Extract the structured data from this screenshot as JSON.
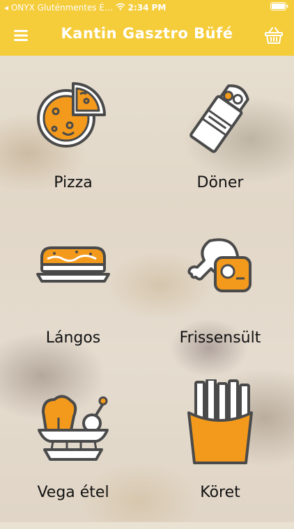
{
  "status_bar": {
    "carrier": "◂ ONYX Gluténmentes É…",
    "time": "2:34 PM"
  },
  "header": {
    "title": "Kantin Gasztro Büfé",
    "menu_icon": "hamburger-menu-icon",
    "cart_icon": "basket-icon"
  },
  "categories": [
    {
      "label": "Pizza",
      "icon": "pizza-icon"
    },
    {
      "label": "Döner",
      "icon": "doner-wrap-icon"
    },
    {
      "label": "Lángos",
      "icon": "langos-icon"
    },
    {
      "label": "Frissensült",
      "icon": "drumstick-steak-icon"
    },
    {
      "label": "Vega étel",
      "icon": "vegetable-bowl-icon"
    },
    {
      "label": "Köret",
      "icon": "fries-icon"
    }
  ],
  "colors": {
    "accent": "#f5cc3a",
    "icon_orange": "#f39a1c",
    "icon_stroke": "#4a4a4a"
  }
}
